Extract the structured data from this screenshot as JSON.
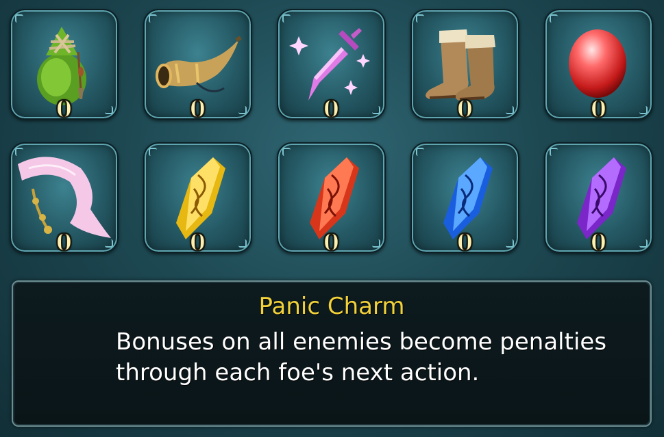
{
  "items": [
    {
      "icon": "green-pouch-icon",
      "count": "0"
    },
    {
      "icon": "horn-icon",
      "count": "0"
    },
    {
      "icon": "pink-dagger-icon",
      "count": "0"
    },
    {
      "icon": "boots-icon",
      "count": "0"
    },
    {
      "icon": "red-gem-icon",
      "count": "0"
    },
    {
      "icon": "pink-scarf-icon",
      "count": "0"
    },
    {
      "icon": "gold-crystal-icon",
      "count": "0"
    },
    {
      "icon": "red-crystal-icon",
      "count": "0"
    },
    {
      "icon": "blue-crystal-icon",
      "count": "0"
    },
    {
      "icon": "purple-crystal-icon",
      "count": "0"
    }
  ],
  "description": {
    "title": "Panic Charm",
    "text": "Bonuses on all enemies become penalties through each foe's next action."
  },
  "colors": {
    "title": "#f2d23a",
    "count": "#fbf0b0",
    "background": "#1d4852"
  }
}
